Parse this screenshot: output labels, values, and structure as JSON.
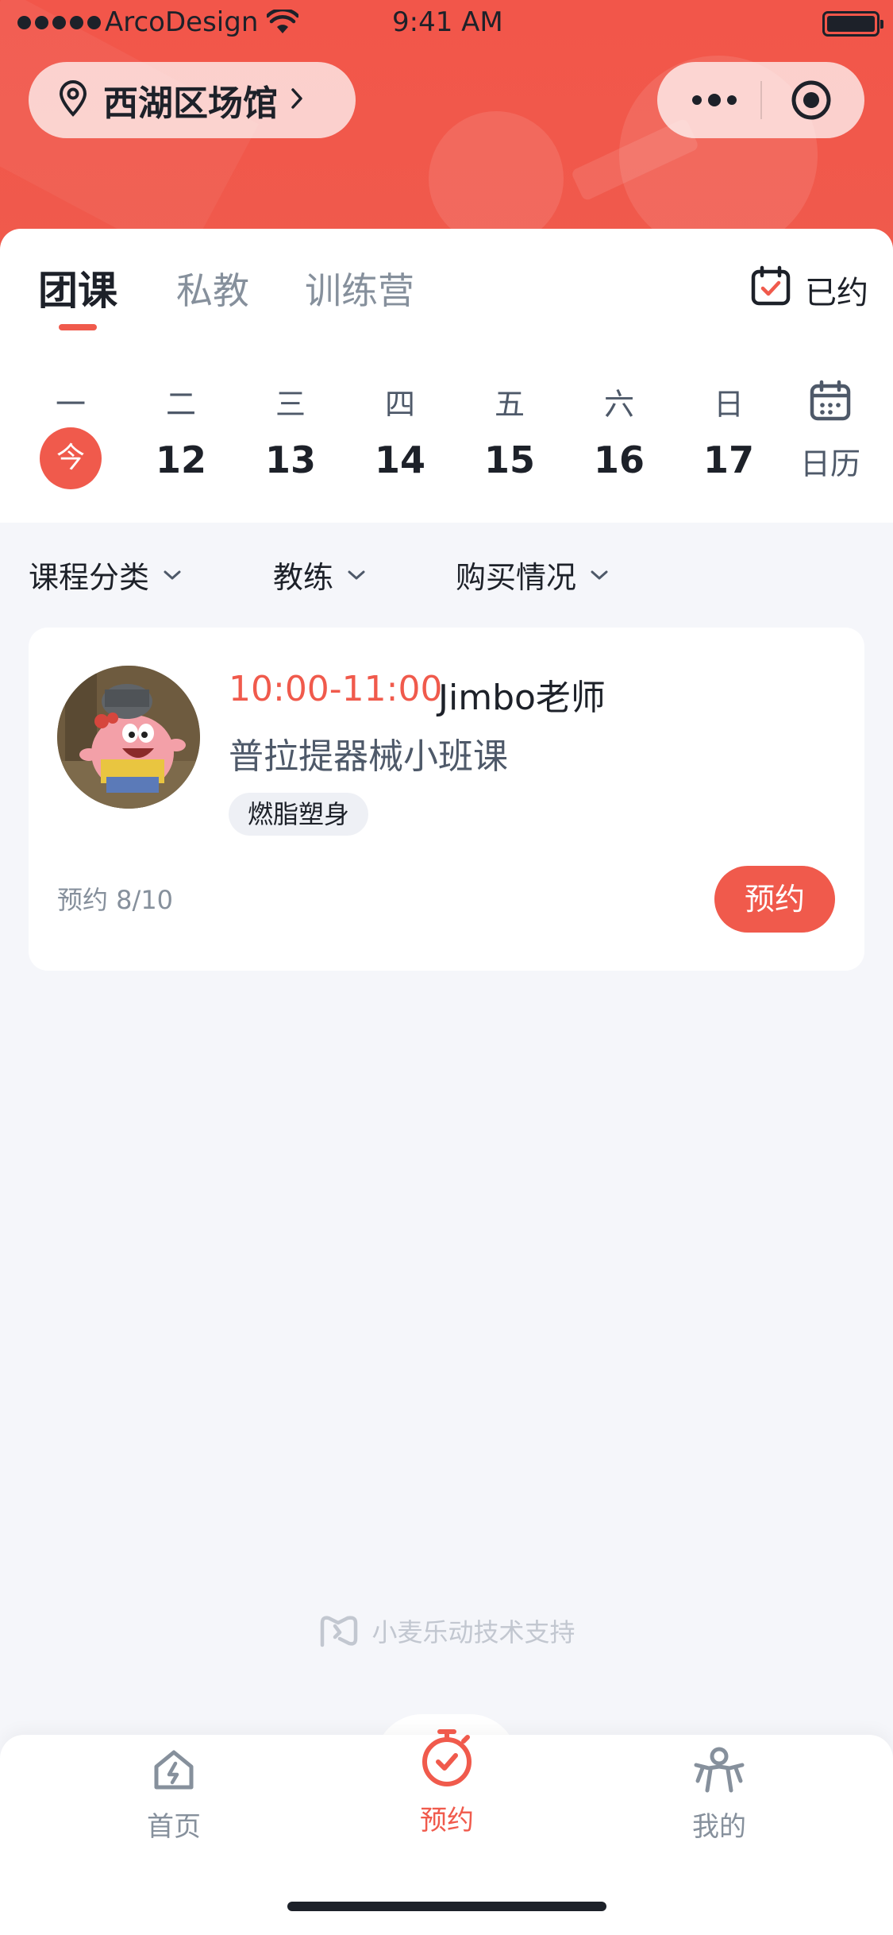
{
  "status_bar": {
    "carrier": "ArcoDesign",
    "time": "9:41 AM"
  },
  "header": {
    "location": "西湖区场馆"
  },
  "tabs": [
    {
      "label": "团课",
      "active": true
    },
    {
      "label": "私教",
      "active": false
    },
    {
      "label": "训练营",
      "active": false
    }
  ],
  "booked_label": "已约",
  "week": [
    {
      "weekday": "一",
      "day": "今",
      "today": true
    },
    {
      "weekday": "二",
      "day": "12"
    },
    {
      "weekday": "三",
      "day": "13"
    },
    {
      "weekday": "四",
      "day": "14"
    },
    {
      "weekday": "五",
      "day": "15"
    },
    {
      "weekday": "六",
      "day": "16"
    },
    {
      "weekday": "日",
      "day": "17"
    }
  ],
  "calendar_label": "日历",
  "filters": [
    {
      "label": "课程分类"
    },
    {
      "label": "教练"
    },
    {
      "label": "购买情况"
    }
  ],
  "course": {
    "time": "10:00-11:00",
    "coach": "Jimbo老师",
    "name": "普拉提器械小班课",
    "tag": "燃脂塑身",
    "booking_count": "预约 8/10",
    "book_button": "预约"
  },
  "powered_by": "小麦乐动技术支持",
  "tabbar": [
    {
      "label": "首页",
      "icon": "home-bolt-icon",
      "active": false
    },
    {
      "label": "预约",
      "icon": "stopwatch-icon",
      "active": true
    },
    {
      "label": "我的",
      "icon": "person-icon",
      "active": false
    }
  ],
  "colors": {
    "brand": "#f05a4c",
    "text_primary": "#1d2129",
    "text_secondary": "#86909c",
    "background": "#f5f6fa"
  }
}
